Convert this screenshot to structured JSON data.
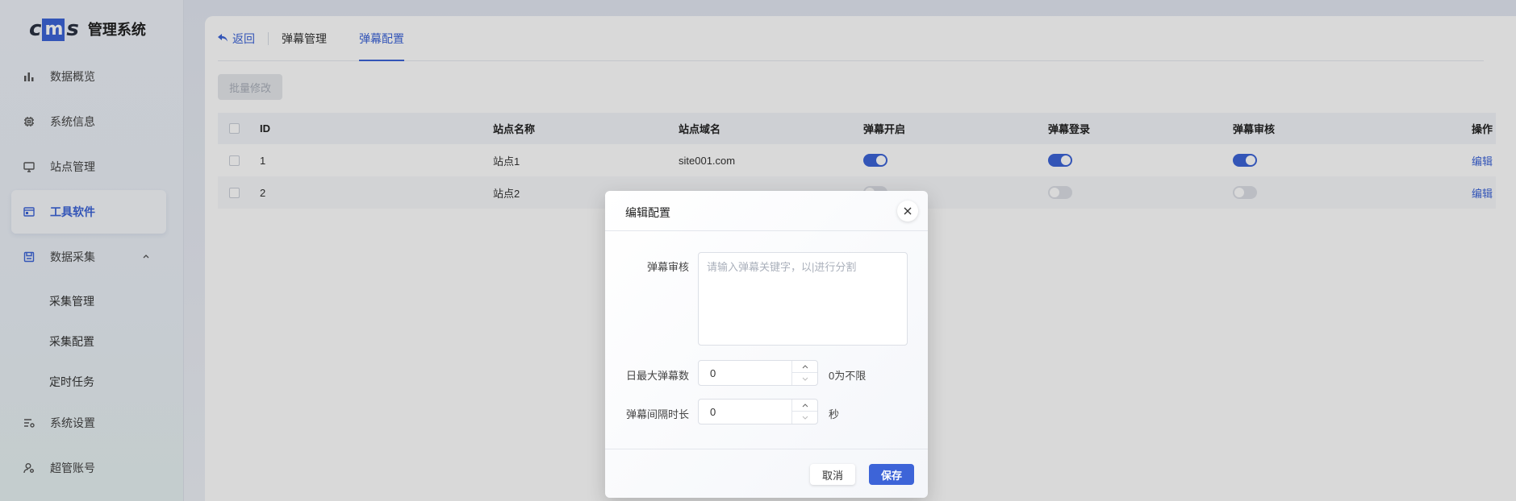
{
  "sidebar": {
    "logo_mark": "cms",
    "logo_text": "管理系统",
    "items": [
      {
        "label": "数据概览",
        "icon": "bar-chart-icon"
      },
      {
        "label": "系统信息",
        "icon": "chip-icon"
      },
      {
        "label": "站点管理",
        "icon": "monitor-icon"
      },
      {
        "label": "工具软件",
        "icon": "window-icon",
        "active": true
      },
      {
        "label": "数据采集",
        "icon": "save-icon",
        "expanded": true
      },
      {
        "label": "系统设置",
        "icon": "settings-list-icon"
      },
      {
        "label": "超管账号",
        "icon": "user-gear-icon"
      }
    ],
    "sub_items": [
      "采集管理",
      "采集配置",
      "定时任务"
    ]
  },
  "tabs": {
    "back": "返回",
    "items": [
      "弹幕管理",
      "弹幕配置"
    ],
    "active": "弹幕配置"
  },
  "toolbar": {
    "batch_edit": "批量修改"
  },
  "table": {
    "columns": [
      "ID",
      "站点名称",
      "站点域名",
      "弹幕开启",
      "弹幕登录",
      "弹幕审核",
      "操作"
    ],
    "rows": [
      {
        "id": "1",
        "name": "站点1",
        "domain": "site001.com",
        "danmu_on": true,
        "danmu_login": true,
        "danmu_review": true,
        "action": "编辑"
      },
      {
        "id": "2",
        "name": "站点2",
        "domain": "",
        "danmu_on": false,
        "danmu_login": false,
        "danmu_review": false,
        "action": "编辑"
      }
    ]
  },
  "dialog": {
    "title": "编辑配置",
    "review_label": "弹幕审核",
    "review_placeholder": "请输入弹幕关键字，以|进行分割",
    "max_label": "日最大弹幕数",
    "max_value": "0",
    "max_hint": "0为不限",
    "interval_label": "弹幕间隔时长",
    "interval_value": "0",
    "interval_unit": "秒",
    "cancel": "取消",
    "save": "保存"
  },
  "colors": {
    "accent": "#3d64d8"
  }
}
